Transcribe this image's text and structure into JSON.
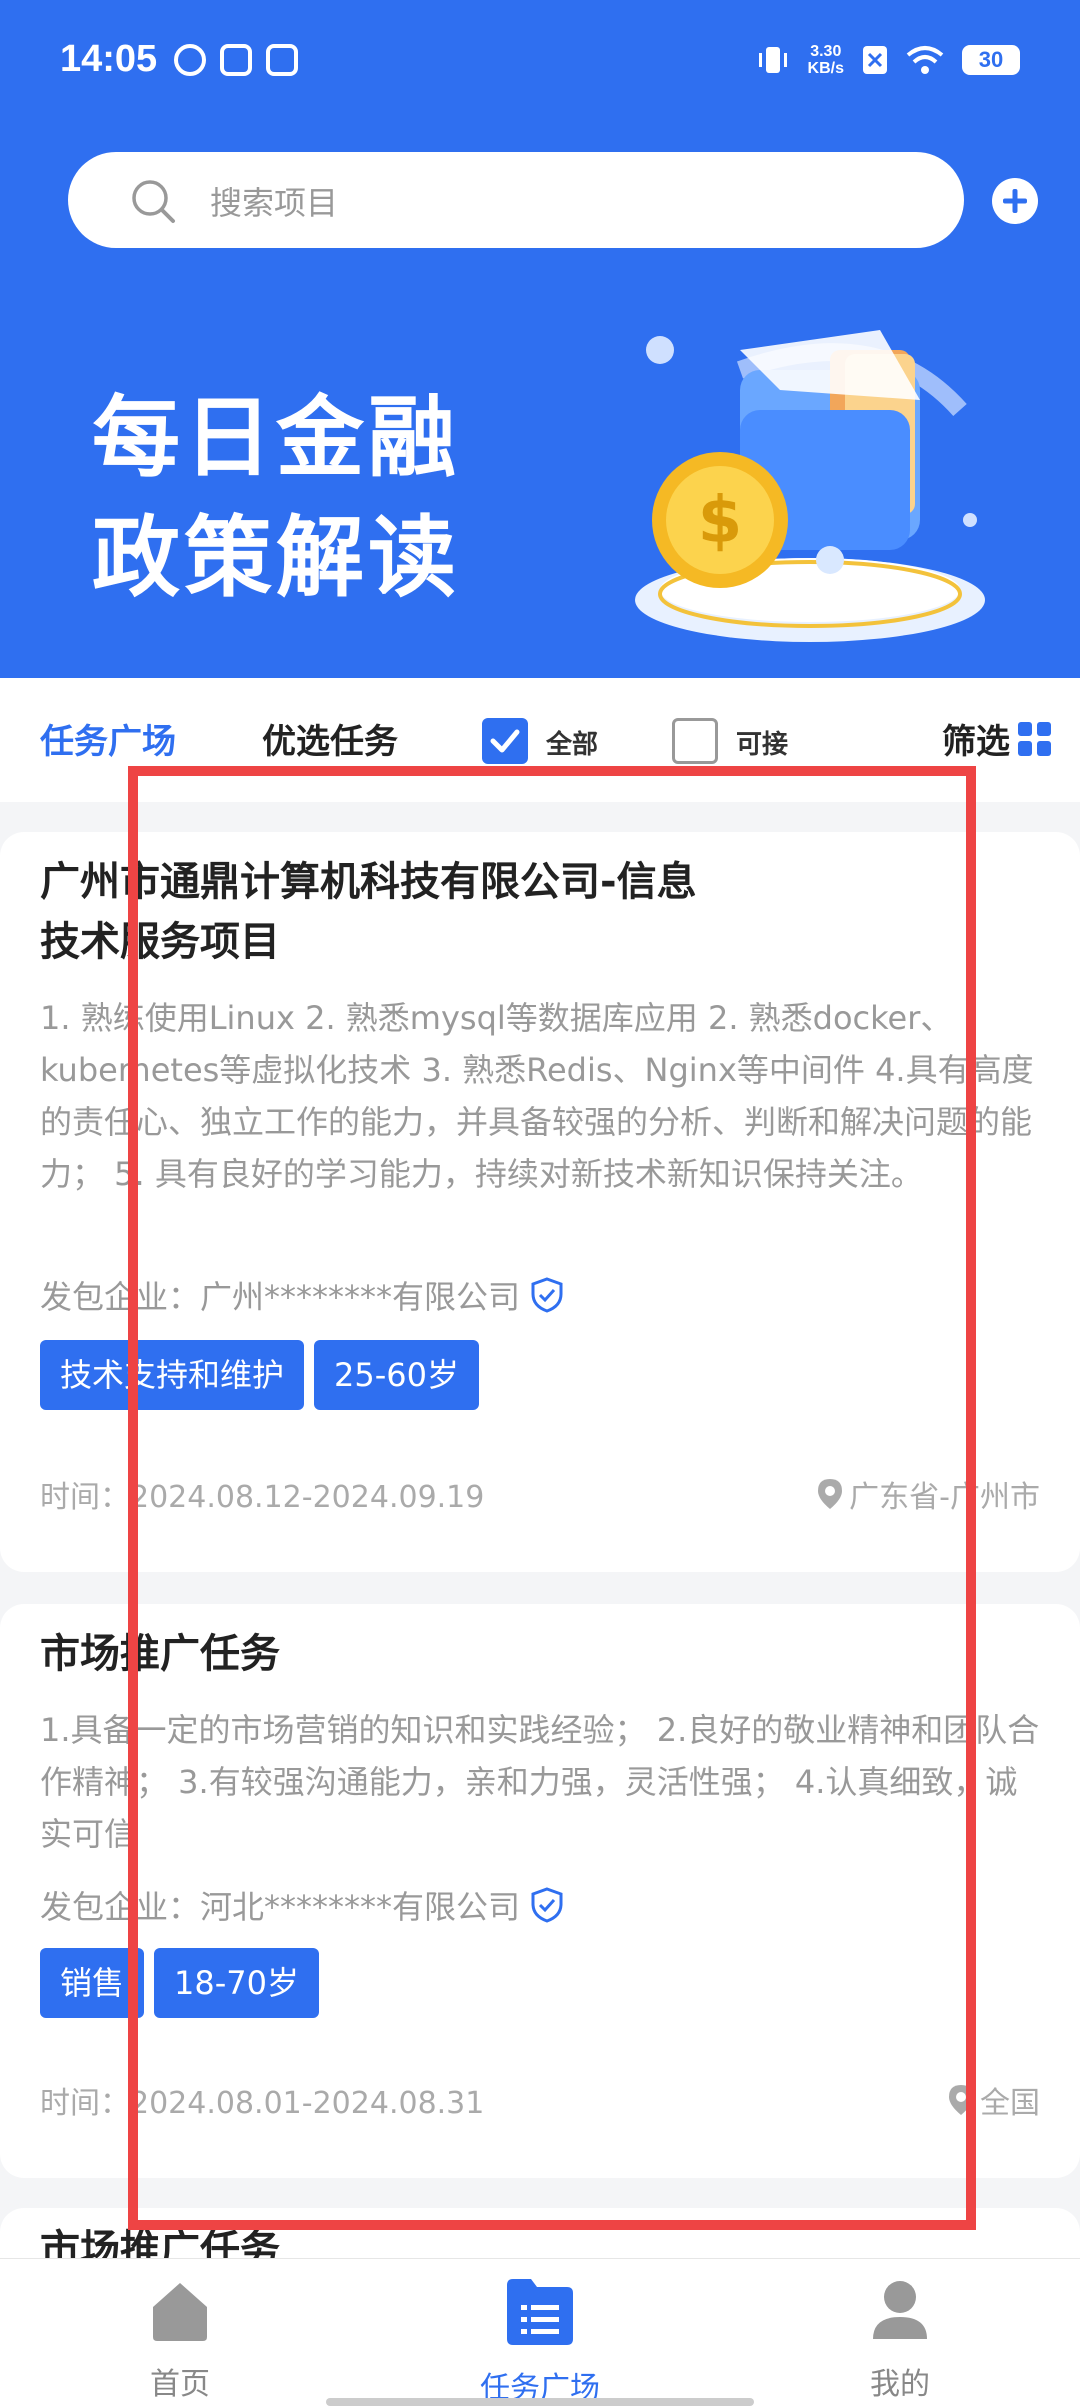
{
  "status_bar": {
    "time": "14:05",
    "net_speed_value": "3.30",
    "net_speed_unit": "KB/s",
    "battery": "30"
  },
  "search": {
    "placeholder": "搜索项目"
  },
  "banner": {
    "line1": "每日金融",
    "line2": "政策解读"
  },
  "filter_bar": {
    "tab_active": "任务广场",
    "tab_preferred": "优选任务",
    "check_all_label": "全部",
    "check_all_checked": true,
    "check_available_label": "可接",
    "check_available_checked": false,
    "filter_label": "筛选"
  },
  "tasks": [
    {
      "title_line1": "广州市通鼎计算机科技有限公司-信息",
      "title_line2": "技术服务项目",
      "description": "1. 熟练使用Linux 2. 熟悉mysql等数据库应用 2. 熟悉docker、kubernetes等虚拟化技术 3. 熟悉Redis、Nginx等中间件 4.具有高度的责任心、独立工作的能力，并具备较强的分析、判断和解决问题的能力； 5. 具有良好的学习能力，持续对新技术新知识保持关注。",
      "company": "发包企业：广州********有限公司",
      "tags": [
        "技术支持和维护",
        "25-60岁"
      ],
      "time": "时间：2024.08.12-2024.09.19",
      "location": "广东省-广州市"
    },
    {
      "title_line1": "市场推广任务",
      "description": "1.具备一定的市场营销的知识和实践经验； 2.良好的敬业精神和团队合作精神； 3.有较强沟通能力，亲和力强，灵活性强； 4.认真细致，诚实可信",
      "company": "发包企业：河北********有限公司",
      "tags": [
        "销售",
        "18-70岁"
      ],
      "time": "时间：2024.08.01-2024.08.31",
      "location": "全国"
    },
    {
      "title_line1": "市场推广任务"
    }
  ],
  "bottom_nav": [
    {
      "label": "首页",
      "icon": "home-icon"
    },
    {
      "label": "任务广场",
      "icon": "task-list-icon"
    },
    {
      "label": "我的",
      "icon": "profile-icon"
    }
  ],
  "colors": {
    "primary": "#2f6ff0",
    "highlight_box": "#ee4444"
  }
}
